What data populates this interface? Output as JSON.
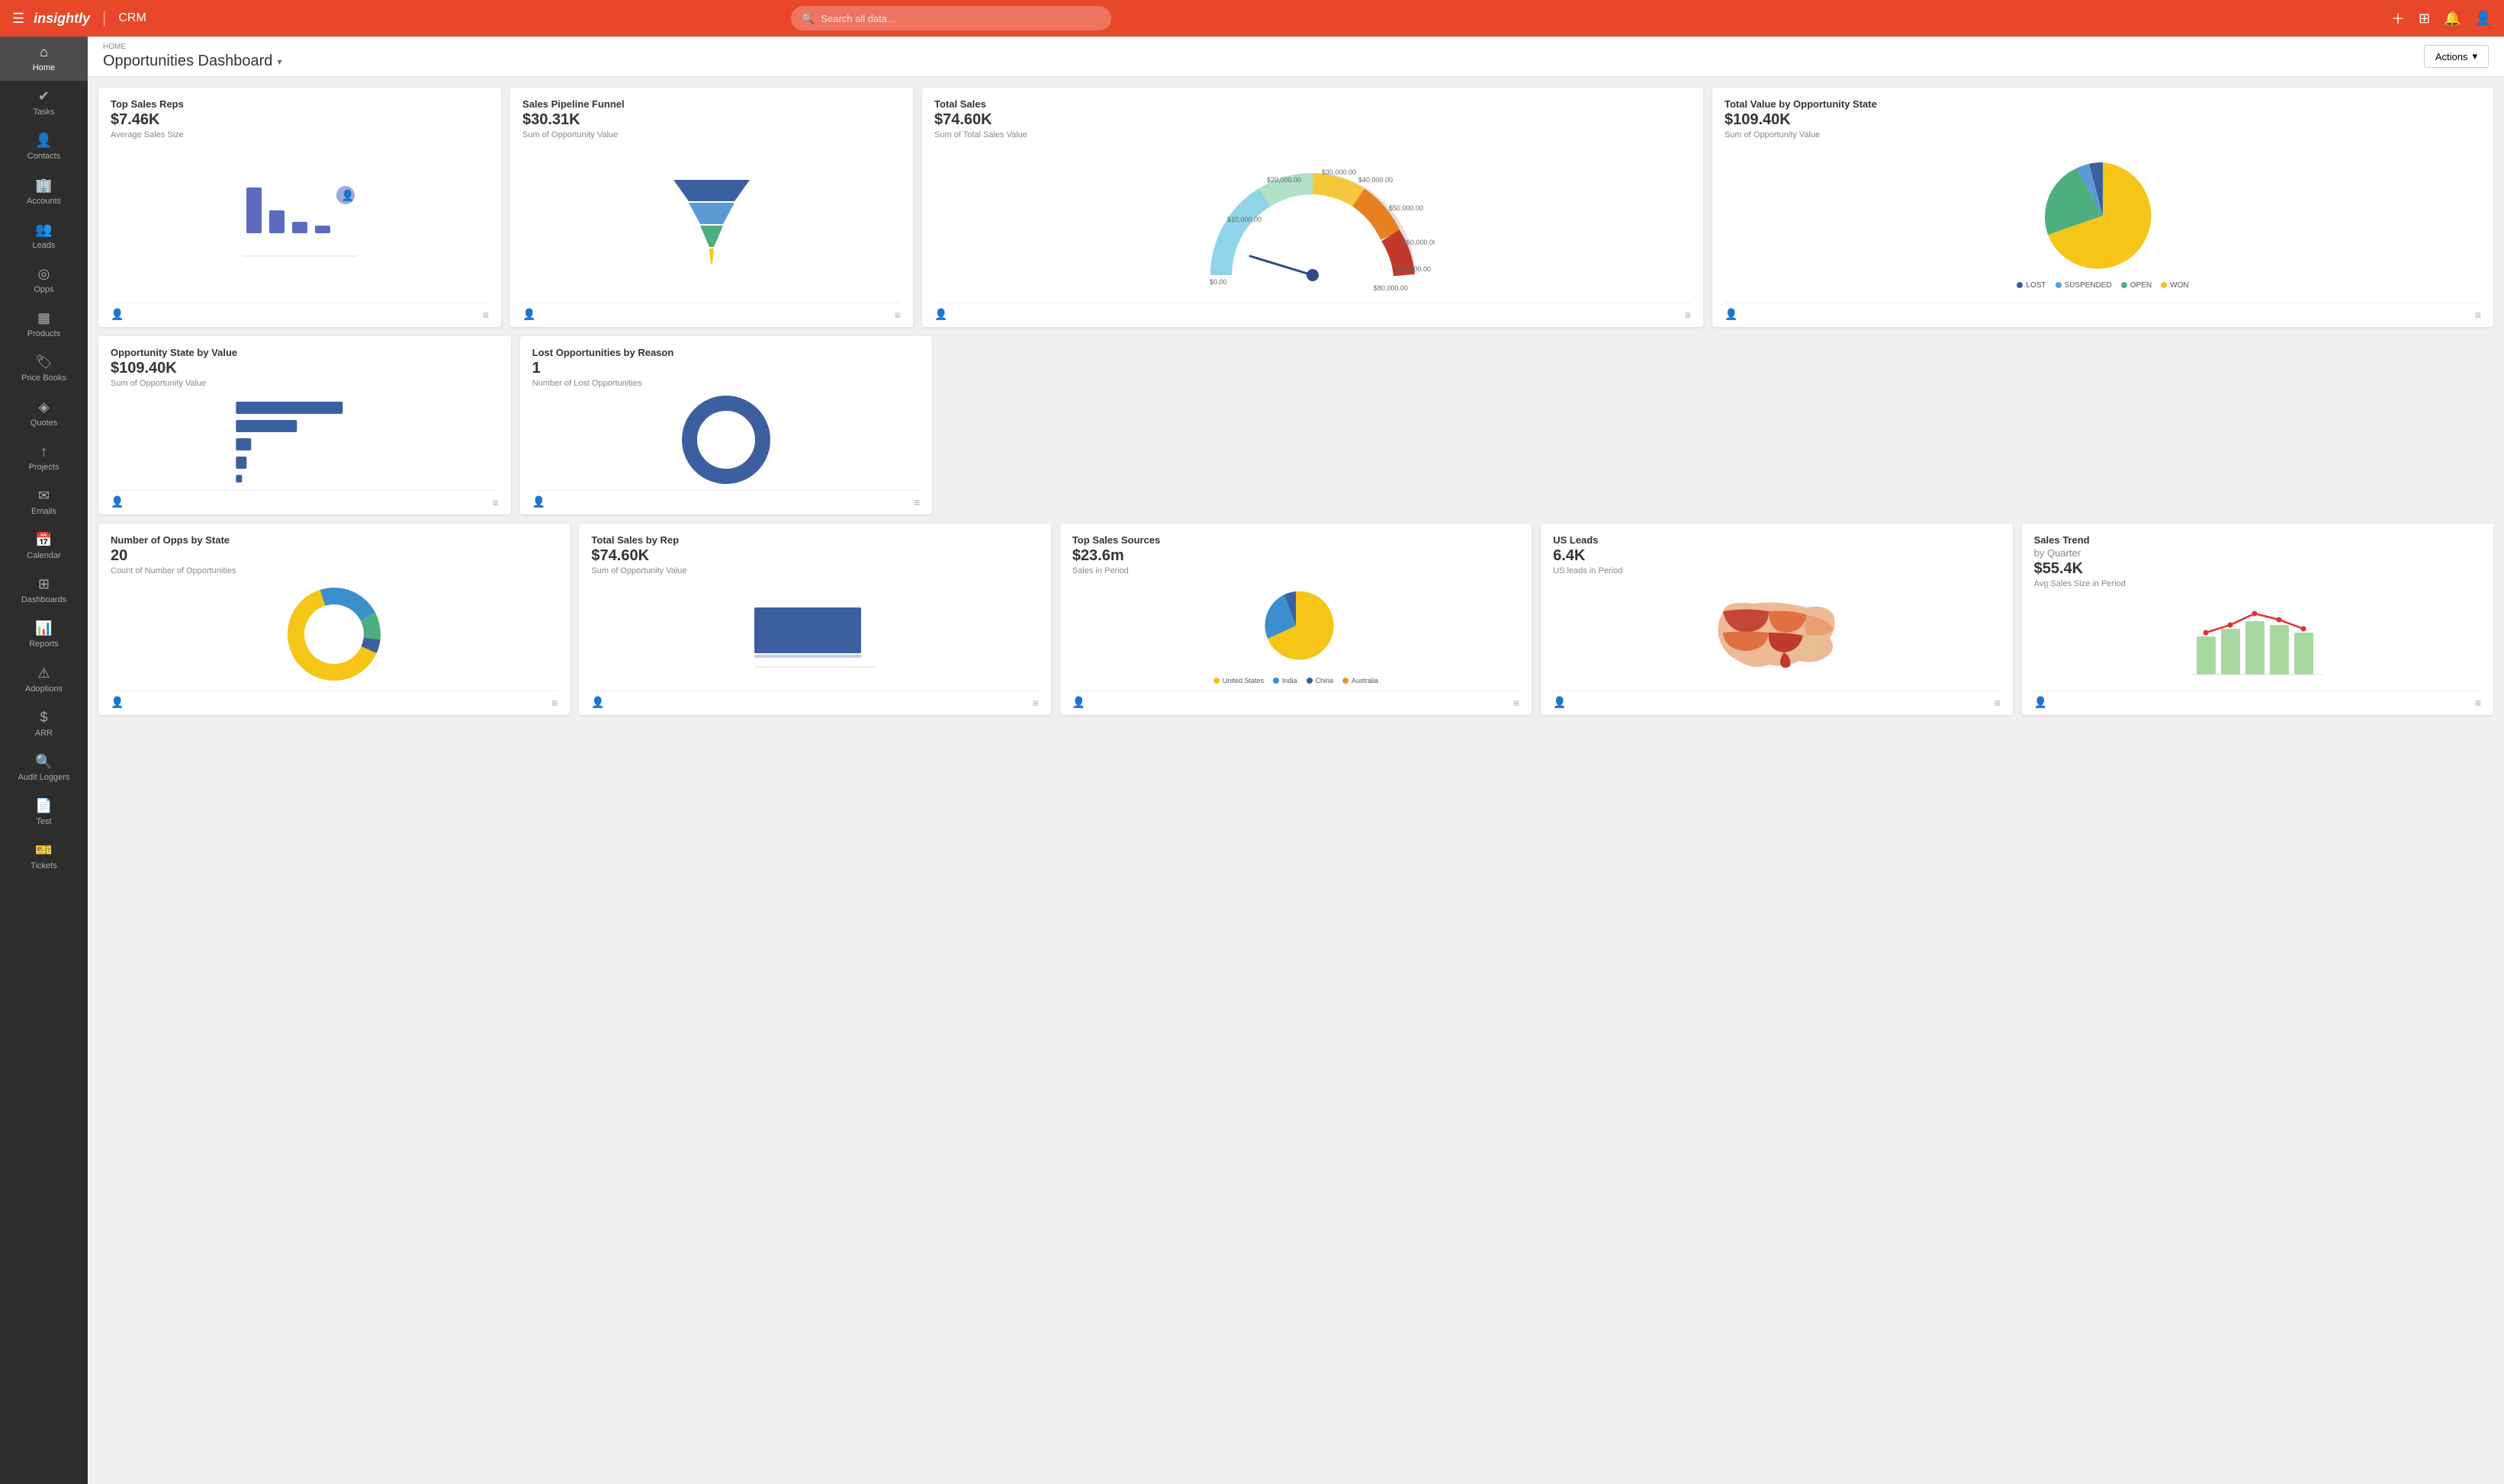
{
  "app": {
    "logo": "insightly",
    "divider": "|",
    "crm": "CRM",
    "search_placeholder": "Search all data..."
  },
  "breadcrumb": "HOME",
  "page_title": "Opportunities Dashboard",
  "actions_label": "Actions",
  "sidebar": {
    "items": [
      {
        "id": "home",
        "icon": "⌂",
        "label": "Home",
        "active": true
      },
      {
        "id": "tasks",
        "icon": "✓",
        "label": "Tasks"
      },
      {
        "id": "contacts",
        "icon": "👤",
        "label": "Contacts"
      },
      {
        "id": "accounts",
        "icon": "🏢",
        "label": "Accounts"
      },
      {
        "id": "leads",
        "icon": "👥",
        "label": "Leads"
      },
      {
        "id": "opps",
        "icon": "◎",
        "label": "Opps"
      },
      {
        "id": "products",
        "icon": "▦",
        "label": "Products"
      },
      {
        "id": "price-books",
        "icon": "🏷",
        "label": "Price Books"
      },
      {
        "id": "quotes",
        "icon": "◈",
        "label": "Quotes"
      },
      {
        "id": "projects",
        "icon": "↑",
        "label": "Projects"
      },
      {
        "id": "emails",
        "icon": "✉",
        "label": "Emails"
      },
      {
        "id": "calendar",
        "icon": "▦",
        "label": "Calendar"
      },
      {
        "id": "dashboards",
        "icon": "⊞",
        "label": "Dashboards"
      },
      {
        "id": "reports",
        "icon": "▌▌",
        "label": "Reports"
      },
      {
        "id": "adoptions",
        "icon": "⚠",
        "label": "Adoptions"
      },
      {
        "id": "arr",
        "icon": "$",
        "label": "ARR"
      },
      {
        "id": "audit",
        "icon": "👤",
        "label": "Audit Loggers"
      },
      {
        "id": "test",
        "icon": "📄",
        "label": "Test"
      },
      {
        "id": "tickets",
        "icon": "🎫",
        "label": "Tickets"
      }
    ]
  },
  "widgets": {
    "row1": [
      {
        "id": "top-sales-reps",
        "title": "Top Sales Reps",
        "value": "$7.46K",
        "subtitle": "Average Sales Size",
        "size": "w-1"
      },
      {
        "id": "sales-pipeline-funnel",
        "title": "Sales Pipeline Funnel",
        "value": "$30.31K",
        "subtitle": "Sum of Opportunity Value",
        "size": "w-1"
      },
      {
        "id": "total-sales",
        "title": "Total Sales",
        "value": "$74.60K",
        "subtitle": "Sum of Total Sales Value",
        "size": "w-2"
      },
      {
        "id": "total-value-by-state",
        "title": "Total Value by Opportunity State",
        "value": "$109.40K",
        "subtitle": "Sum of Opportunity Value",
        "size": "w-2"
      }
    ],
    "row2": [
      {
        "id": "opportunity-state-by-value",
        "title": "Opportunity State by Value",
        "value": "$109.40K",
        "subtitle": "Sum of Opportunity Value",
        "size": "w-1"
      },
      {
        "id": "lost-opportunities",
        "title": "Lost Opportunities by Reason",
        "value": "1",
        "subtitle": "Number of Lost Opportunities",
        "size": "w-1"
      }
    ],
    "row3": [
      {
        "id": "num-opps-by-state",
        "title": "Number of Opps by State",
        "value": "20",
        "subtitle": "Count of Number of Opportunities",
        "size": "w-1"
      },
      {
        "id": "total-sales-by-rep",
        "title": "Total Sales by Rep",
        "value": "$74.60K",
        "subtitle": "Sum of Opportunity Value",
        "size": "w-1"
      },
      {
        "id": "top-sales-sources",
        "title": "Top Sales Sources",
        "value": "$23.6m",
        "subtitle": "Sales in Period",
        "size": "w-1"
      },
      {
        "id": "us-leads",
        "title": "US Leads",
        "value": "6.4K",
        "subtitle": "US leads in Period",
        "size": "w-1"
      },
      {
        "id": "sales-trend",
        "title": "Sales Trend",
        "value": "by Quarter",
        "subtitle": "$55.4K",
        "subtitle2": "Avg Sales Size in Period",
        "size": "w-1"
      }
    ]
  },
  "legend_pie": {
    "items": [
      {
        "label": "LOST",
        "color": "#3c5fa0"
      },
      {
        "label": "SUSPENDED",
        "color": "#6699cc"
      },
      {
        "label": "OPEN",
        "color": "#4caf7d"
      },
      {
        "label": "WON",
        "color": "#f0c040"
      }
    ]
  },
  "legend_sources": {
    "items": [
      {
        "label": "United States",
        "color": "#f0c040"
      },
      {
        "label": "India",
        "color": "#3c8fce"
      },
      {
        "label": "China",
        "color": "#3c5fa0"
      },
      {
        "label": "Australia",
        "color": "#e8953a"
      }
    ]
  }
}
